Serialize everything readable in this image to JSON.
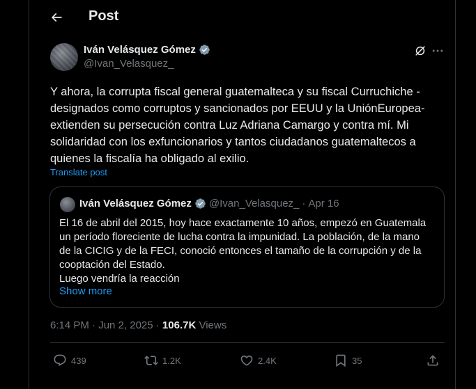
{
  "header": {
    "title": "Post"
  },
  "post": {
    "author_name": "Iván Velásquez Gómez",
    "author_handle": "@Ivan_Velasquez_",
    "text": "Y ahora, la corrupta fiscal general guatemalteca y su fiscal Curruchiche -\ndesignados como corruptos y sancionados por EEUU y la UniónEuropea-\nextienden su persecución contra Luz Adriana Camargo y contra mí. Mi\nsolidaridad con los exfuncionarios y tantos ciudadanos guatemaltecos a\nquienes la fiscalía ha obligado al exilio.",
    "translate_label": "Translate post",
    "time": "6:14 PM · Jun 2, 2025 · ",
    "views_count": "106.7K",
    "views_label": " Views"
  },
  "quote": {
    "author_name": "Iván Velásquez Gómez",
    "author_handle": "@Ivan_Velasquez_",
    "separator": "·",
    "date": "Apr 16",
    "text": "El 16 de abril del 2015, hoy hace exactamente 10 años, empezó en Guatemala\nun período floreciente de lucha contra la impunidad. La población, de la mano\nde la CICIG y de la FECI, conoció entonces el tamaño de la corrupción y de la\ncooptación del Estado.\nLuego vendría la reacción",
    "show_more": "Show more"
  },
  "actions": {
    "replies": "439",
    "reposts": "1.2K",
    "likes": "2.4K",
    "bookmarks": "35"
  },
  "colors": {
    "background": "#000000",
    "text": "#e7e9ea",
    "secondary": "#71767b",
    "accent": "#1d9bf0",
    "border": "#2f3336"
  },
  "icons": [
    "back-arrow-icon",
    "verified-badge-icon",
    "grok-icon",
    "more-icon",
    "reply-icon",
    "repost-icon",
    "like-icon",
    "bookmark-icon",
    "share-icon"
  ]
}
